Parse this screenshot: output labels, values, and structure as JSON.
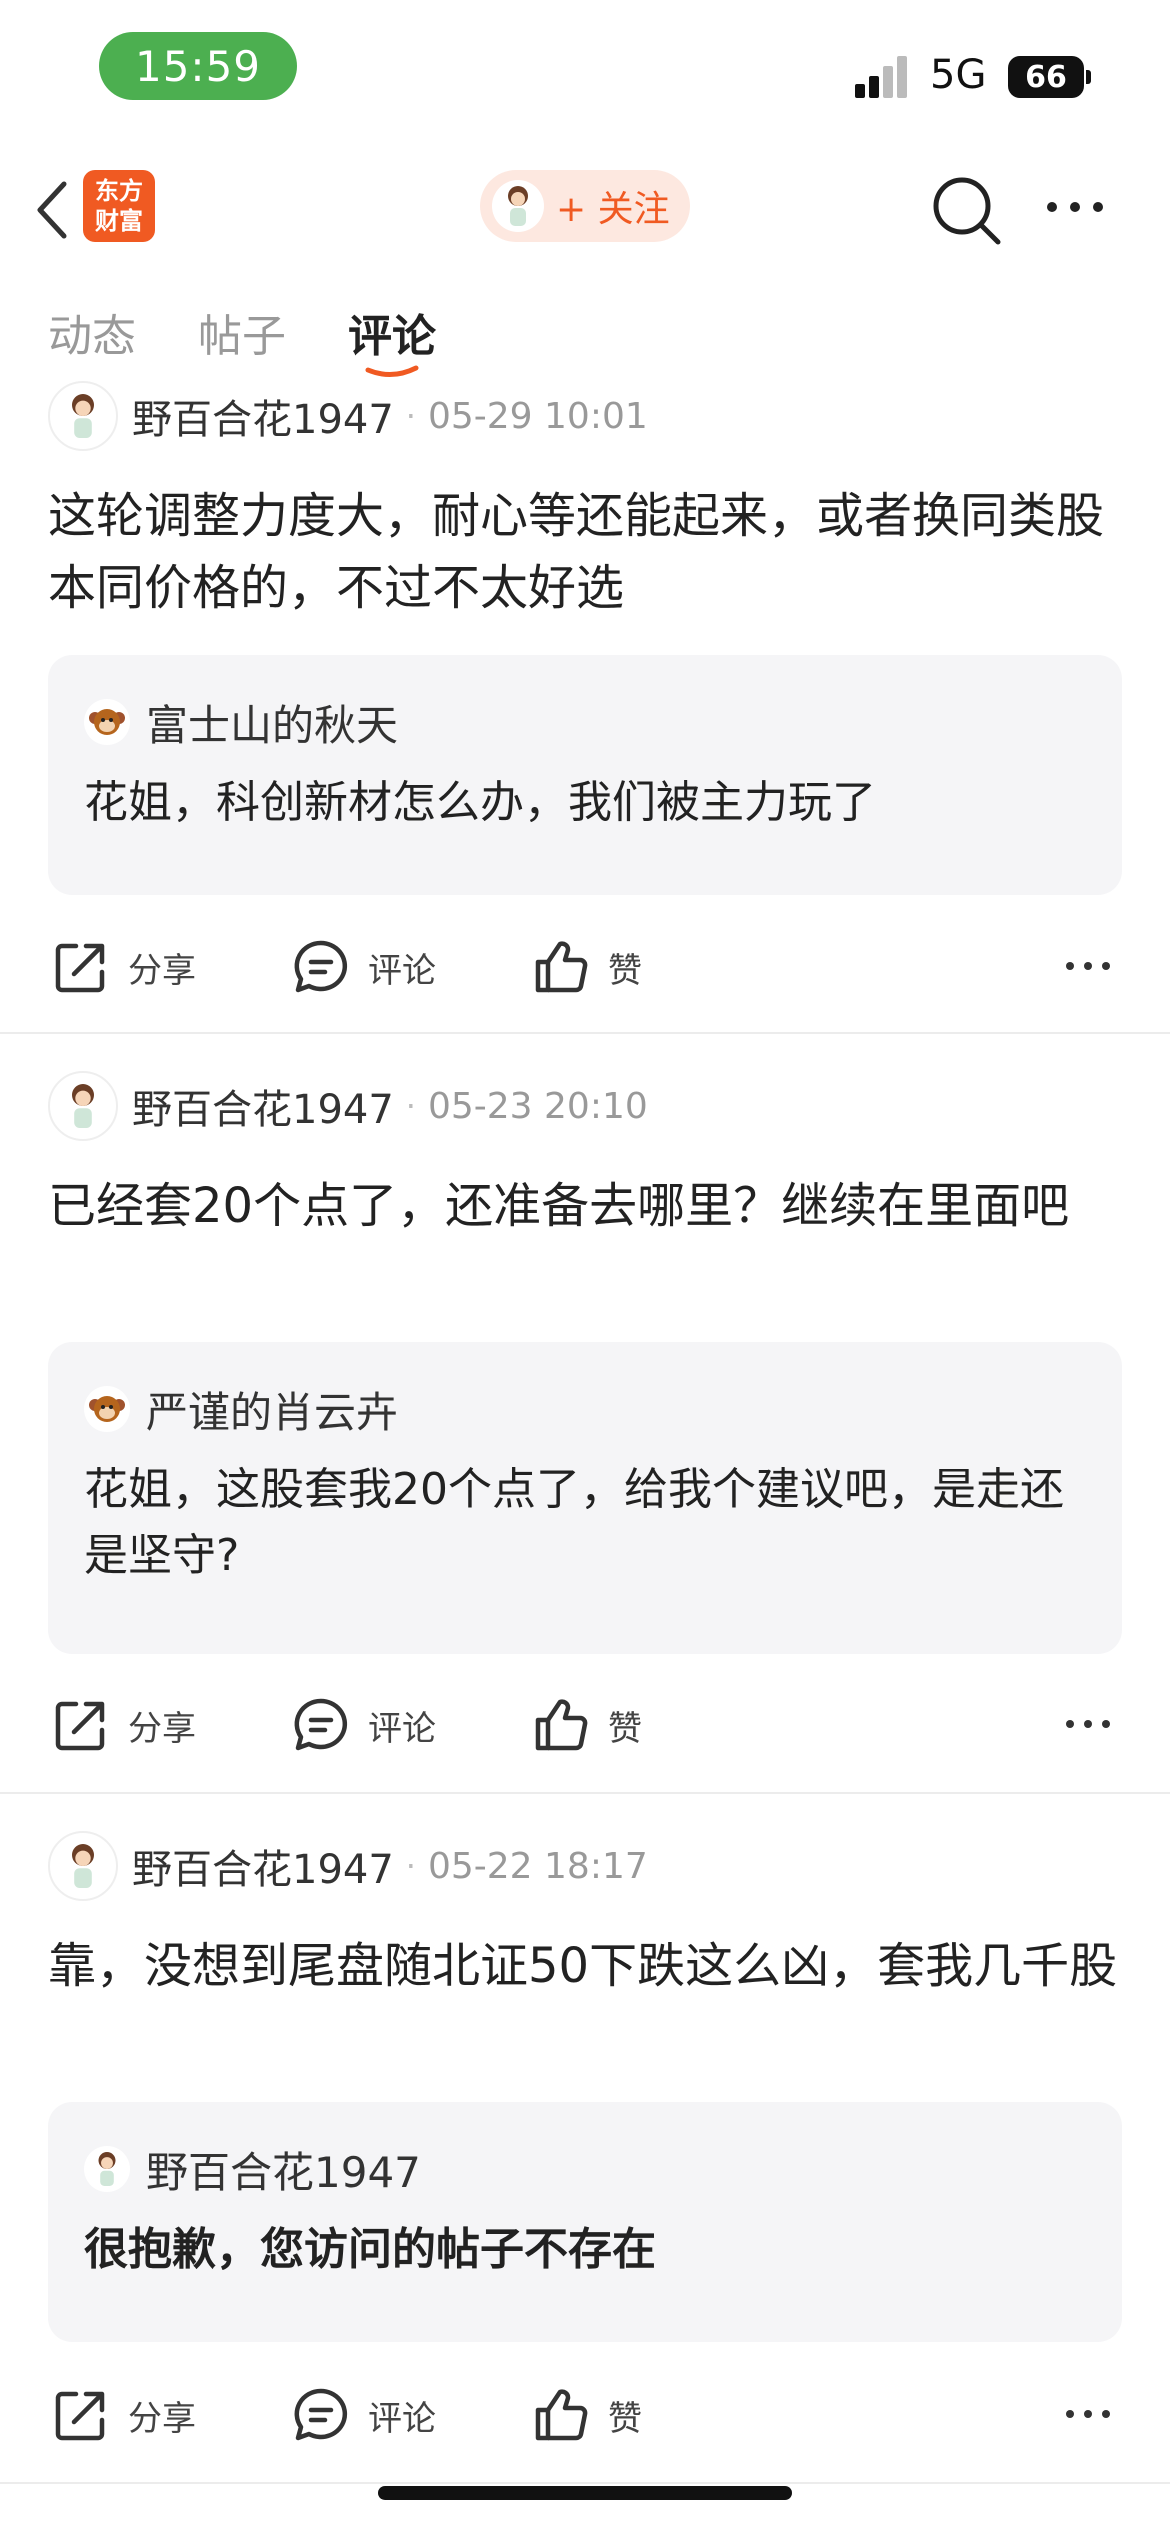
{
  "status_bar": {
    "time": "15:59",
    "network": "5G",
    "battery": "66"
  },
  "nav": {
    "logo_line1": "东方",
    "logo_line2": "财富",
    "follow_label": "+ 关注"
  },
  "tabs": [
    {
      "label": "动态",
      "active": false
    },
    {
      "label": "帖子",
      "active": false
    },
    {
      "label": "评论",
      "active": true
    }
  ],
  "colors": {
    "accent": "#f05a22",
    "status_green": "#4caf50",
    "quote_bg": "#f5f5f7"
  },
  "comments": [
    {
      "author": "野百合花1947",
      "time": "05-29 10:01",
      "text": "这轮调整力度大，耐心等还能起来，或者换同类股本同价格的，不过不太好选",
      "quote_user": "富士山的秋天",
      "quote_text": "花姐，科创新材怎么办，我们被主力玩了",
      "quote_avatar": "monkey-avatar"
    },
    {
      "author": "野百合花1947",
      "time": "05-23 20:10",
      "text": "已经套20个点了，还准备去哪里？继续在里面吧",
      "quote_user": "严谨的肖云卉",
      "quote_text": "花姐，这股套我20个点了，给我个建议吧，是走还是坚守?",
      "quote_avatar": "monkey-avatar"
    },
    {
      "author": "野百合花1947",
      "time": "05-22 18:17",
      "text": "靠，没想到尾盘随北证50下跌这么凶，套我几千股",
      "quote_user": "野百合花1947",
      "quote_text": "很抱歉，您访问的帖子不存在",
      "quote_avatar": "girl-avatar"
    }
  ],
  "actions": {
    "share": "分享",
    "comment": "评论",
    "like": "赞"
  }
}
